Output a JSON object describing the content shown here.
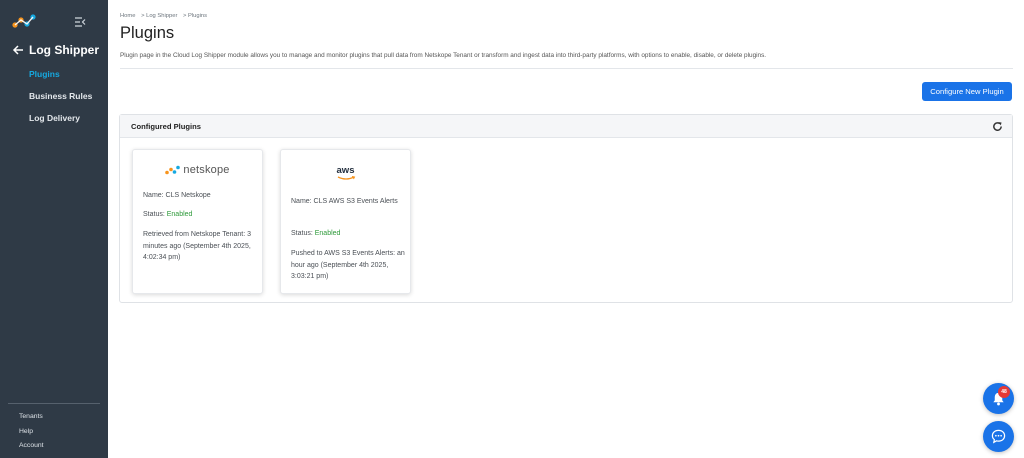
{
  "sidebar": {
    "back_label": "Log Shipper",
    "items": [
      {
        "label": "Plugins",
        "active": true
      },
      {
        "label": "Business Rules",
        "active": false
      },
      {
        "label": "Log Delivery",
        "active": false
      }
    ],
    "bottom_links": [
      "Tenants",
      "Help",
      "Account"
    ],
    "icons": {
      "logo": "netskope-logo-icon",
      "collapse": "collapse-menu-icon",
      "back": "arrow-left-icon"
    }
  },
  "breadcrumb": [
    "Home",
    "Log Shipper",
    "Plugins"
  ],
  "breadcrumb_separator": ">",
  "page": {
    "title": "Plugins",
    "description": "Plugin page in the Cloud Log Shipper module allows you to manage and monitor plugins that pull data from Netskope Tenant or transform and ingest data into third-party platforms, with options to enable, disable, or delete plugins."
  },
  "actions": {
    "configure_label": "Configure New Plugin"
  },
  "panel": {
    "title": "Configured Plugins",
    "refresh_icon": "refresh-icon"
  },
  "plugins": [
    {
      "logo_text": "netskope",
      "name": "Name: CLS Netskope",
      "status_prefix": "Status: ",
      "status": "Enabled",
      "detail": "Retrieved from Netskope Tenant: 3 minutes ago (September 4th 2025, 4:02:34 pm)"
    },
    {
      "logo_text": "aws",
      "name": "Name: CLS AWS S3 Events Alerts",
      "status_prefix": "Status: ",
      "status": "Enabled",
      "detail": "Pushed to AWS S3 Events Alerts: an hour ago (September 4th 2025, 3:03:21 pm)"
    }
  ],
  "floating": {
    "notification_count": "48",
    "bell_icon": "bell-icon",
    "chat_icon": "chat-icon"
  },
  "colors": {
    "sidebar_bg": "#2f3a46",
    "active_nav": "#16a9e0",
    "primary": "#1a73e8",
    "enabled": "#2e9a3a",
    "badge": "#e53935"
  }
}
